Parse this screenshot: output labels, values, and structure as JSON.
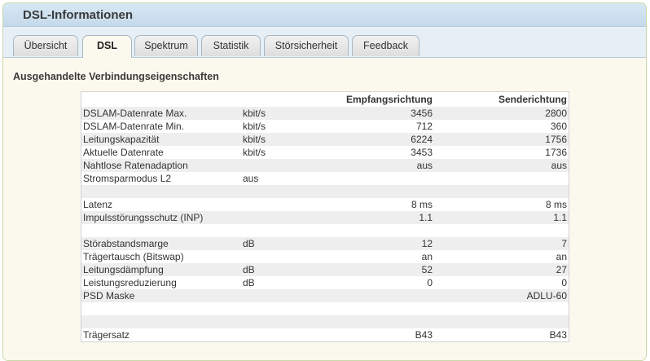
{
  "window": {
    "title": "DSL-Informationen"
  },
  "tabs": [
    {
      "label": "Übersicht",
      "active": false
    },
    {
      "label": "DSL",
      "active": true
    },
    {
      "label": "Spektrum",
      "active": false
    },
    {
      "label": "Statistik",
      "active": false
    },
    {
      "label": "Störsicherheit",
      "active": false
    },
    {
      "label": "Feedback",
      "active": false
    }
  ],
  "section": {
    "heading": "Ausgehandelte Verbindungseigenschaften"
  },
  "table": {
    "columns": {
      "label": "",
      "unit": "",
      "downstream": "Empfangsrichtung",
      "upstream": "Senderichtung"
    },
    "rows": [
      {
        "label": "DSLAM-Datenrate Max.",
        "unit": "kbit/s",
        "down": "3456",
        "up": "2800"
      },
      {
        "label": "DSLAM-Datenrate Min.",
        "unit": "kbit/s",
        "down": "712",
        "up": "360"
      },
      {
        "label": "Leitungskapazität",
        "unit": "kbit/s",
        "down": "6224",
        "up": "1756"
      },
      {
        "label": "Aktuelle Datenrate",
        "unit": "kbit/s",
        "down": "3453",
        "up": "1736"
      },
      {
        "label": "Nahtlose Ratenadaption",
        "unit": "",
        "down": "aus",
        "up": "aus"
      },
      {
        "label": "Stromsparmodus L2",
        "unit": "aus",
        "down": "",
        "up": ""
      },
      {
        "label": "",
        "unit": "",
        "down": "",
        "up": ""
      },
      {
        "label": "Latenz",
        "unit": "",
        "down": "8 ms",
        "up": "8 ms"
      },
      {
        "label": "Impulsstörungsschutz (INP)",
        "unit": "",
        "down": "1.1",
        "up": "1.1"
      },
      {
        "label": "",
        "unit": "",
        "down": "",
        "up": ""
      },
      {
        "label": "Störabstandsmarge",
        "unit": "dB",
        "down": "12",
        "up": "7"
      },
      {
        "label": "Trägertausch (Bitswap)",
        "unit": "",
        "down": "an",
        "up": "an"
      },
      {
        "label": "Leitungsdämpfung",
        "unit": "dB",
        "down": "52",
        "up": "27"
      },
      {
        "label": "Leistungsreduzierung",
        "unit": "dB",
        "down": "0",
        "up": "0"
      },
      {
        "label": "PSD Maske",
        "unit": "",
        "down": "",
        "up": "ADLU-60"
      },
      {
        "label": "",
        "unit": "",
        "down": "",
        "up": ""
      },
      {
        "label": "",
        "unit": "",
        "down": "",
        "up": ""
      },
      {
        "label": "Trägersatz",
        "unit": "",
        "down": "B43",
        "up": "B43"
      }
    ]
  }
}
